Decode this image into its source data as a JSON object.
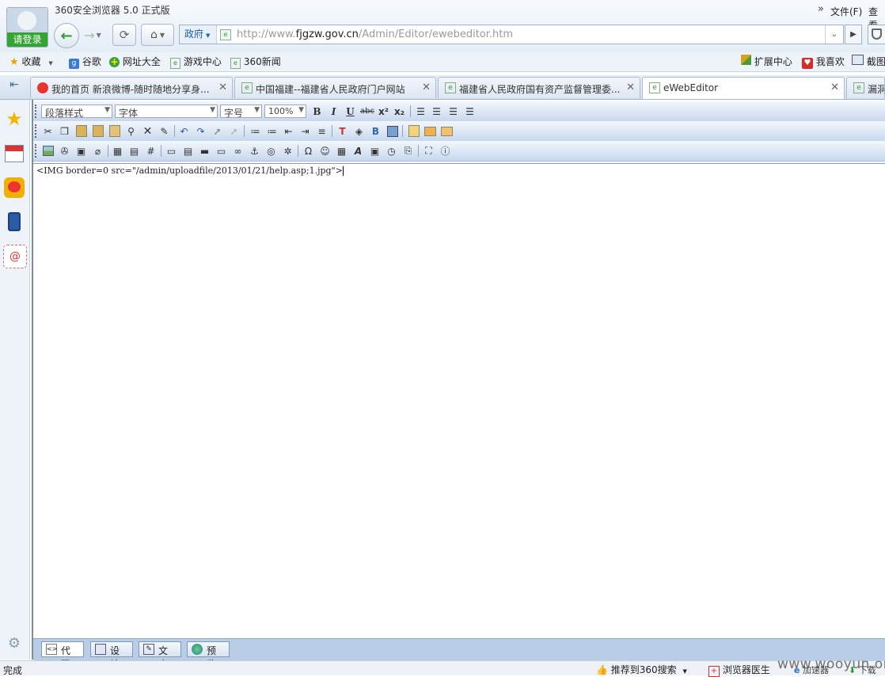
{
  "browser": {
    "title": "360安全浏览器 5.0 正式版",
    "login_label": "请登录",
    "menu_more": "»",
    "menu_file": "文件(F)",
    "menu_view": "查看",
    "address_mode": "政府",
    "url_prefix": "http://www.",
    "url_domain": "fjgzw.gov.cn",
    "url_path": "/Admin/Editor/ewebeditor.htm"
  },
  "bookmarks": {
    "items": [
      {
        "label": "收藏",
        "icon": "star-icon"
      },
      {
        "label": "谷歌",
        "icon": "google-icon"
      },
      {
        "label": "网址大全",
        "icon": "plus-icon"
      },
      {
        "label": "游戏中心",
        "icon": "ie-icon"
      },
      {
        "label": "360新闻",
        "icon": "ie-icon"
      }
    ],
    "right": [
      {
        "label": "扩展中心",
        "icon": "cube-icon"
      },
      {
        "label": "我喜欢",
        "icon": "heart-icon"
      },
      {
        "label": "截图",
        "icon": "screenshot-icon"
      }
    ]
  },
  "tabs": [
    {
      "label": "我的首页 新浪微博-随时随地分享身...",
      "icon": "weibo-icon"
    },
    {
      "label": "中国福建--福建省人民政府门户网站",
      "icon": "ie-icon"
    },
    {
      "label": "福建省人民政府国有资产监督管理委...",
      "icon": "ie-icon"
    },
    {
      "label": "eWebEditor",
      "icon": "ie-icon"
    },
    {
      "label": "漏洞",
      "icon": "ie-icon"
    }
  ],
  "toolbar": {
    "paragraph_style": "段落样式",
    "font_family": "字体",
    "font_size": "字号",
    "zoom": "100%",
    "bold": "B",
    "italic": "I",
    "underline": "U",
    "strike": "abc",
    "superscript": "x²",
    "subscript": "x₂"
  },
  "editor": {
    "code_text": "<IMG border=0 src=\"/admin/uploadfile/2013/01/21/help.asp;1.jpg\">"
  },
  "modes": [
    {
      "label": "代码",
      "icon": "code-icon"
    },
    {
      "label": "设计",
      "icon": "design-icon"
    },
    {
      "label": "文本",
      "icon": "text-icon"
    },
    {
      "label": "预览",
      "icon": "preview-icon"
    }
  ],
  "status": {
    "left": "完成",
    "recommend": "推荐到360搜索",
    "doctor": "浏览器医生",
    "watermark": "www.wooyun.org",
    "accel": "加速器",
    "right_extra": "下载"
  },
  "colors": {
    "accent": "#2f6fc0",
    "toolbar_bg": "#c7d8ee",
    "mode_bar": "#b9cde6"
  }
}
